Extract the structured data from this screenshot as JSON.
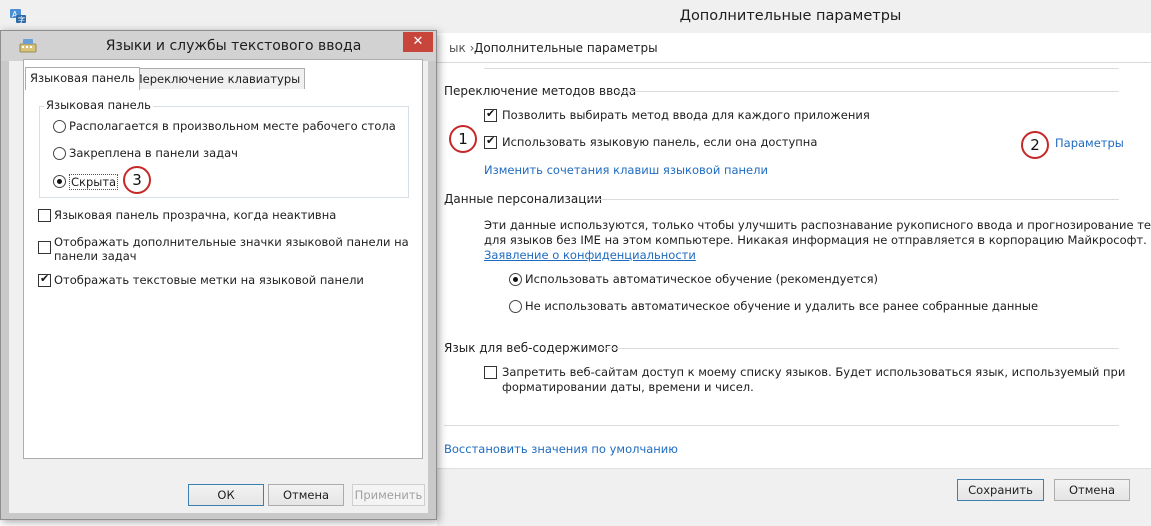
{
  "main_window": {
    "title": "Дополнительные параметры",
    "address_prefix": "ык",
    "address_separator": "›",
    "address_current": "Дополнительные параметры",
    "input_switch": {
      "heading": "Переключение методов ввода",
      "per_app_label": "Позволить выбирать метод ввода для каждого приложения",
      "per_app_checked": true,
      "use_langbar_label": "Использовать языковую панель, если она доступна",
      "use_langbar_checked": true,
      "hotkeys_link": "Изменить сочетания клавиш языковой панели",
      "options_link": "Параметры"
    },
    "personalization": {
      "heading": "Данные персонализации",
      "description_line1": "Эти данные используются, только чтобы улучшить распознавание рукописного ввода и прогнозирование текста",
      "description_line2": "для языков без IME на этом компьютере. Никакая информация не отправляется в корпорацию Майкрософт.",
      "privacy_link": "Заявление о конфиденциальности",
      "option_auto": "Использовать автоматическое обучение (рекомендуется)",
      "option_no_auto": "Не использовать автоматическое обучение и удалить все ранее собранные данные",
      "selected": "auto"
    },
    "web_content": {
      "heading": "Язык для веб-содержимого",
      "deny_label_line1": "Запретить веб-сайтам доступ к моему списку языков. Будет использоваться язык, используемый при",
      "deny_label_line2": "форматировании даты, времени и чисел.",
      "deny_checked": false
    },
    "restore_link": "Восстановить значения по умолчанию",
    "save_button": "Сохранить",
    "cancel_button": "Отмена"
  },
  "dialog": {
    "title": "Языки и службы текстового ввода",
    "close_glyph": "✕",
    "tabs": [
      {
        "label": "Языковая панель",
        "active": true
      },
      {
        "label": "Переключение клавиатуры",
        "active": false
      }
    ],
    "group_label": "Языковая панель",
    "radio_options": [
      {
        "label": "Располагается в произвольном месте рабочего стола",
        "checked": false
      },
      {
        "label": "Закреплена в панели задач",
        "checked": false
      },
      {
        "label": "Скрыта",
        "checked": true
      }
    ],
    "checkboxes": [
      {
        "label": "Языковая панель прозрачна, когда неактивна",
        "checked": false
      },
      {
        "label_line1": "Отображать дополнительные значки языковой панели на",
        "label_line2": "панели задач",
        "checked": false
      },
      {
        "label": "Отображать текстовые метки на языковой панели",
        "checked": true
      }
    ],
    "ok_button": "ОК",
    "cancel_button": "Отмена",
    "apply_button": "Применить"
  },
  "annotations": {
    "badge1": "1",
    "badge2": "2",
    "badge3": "3",
    "color": "#c62828"
  },
  "colors": {
    "link": "#1f6bc1",
    "close_button": "#c7453b"
  }
}
